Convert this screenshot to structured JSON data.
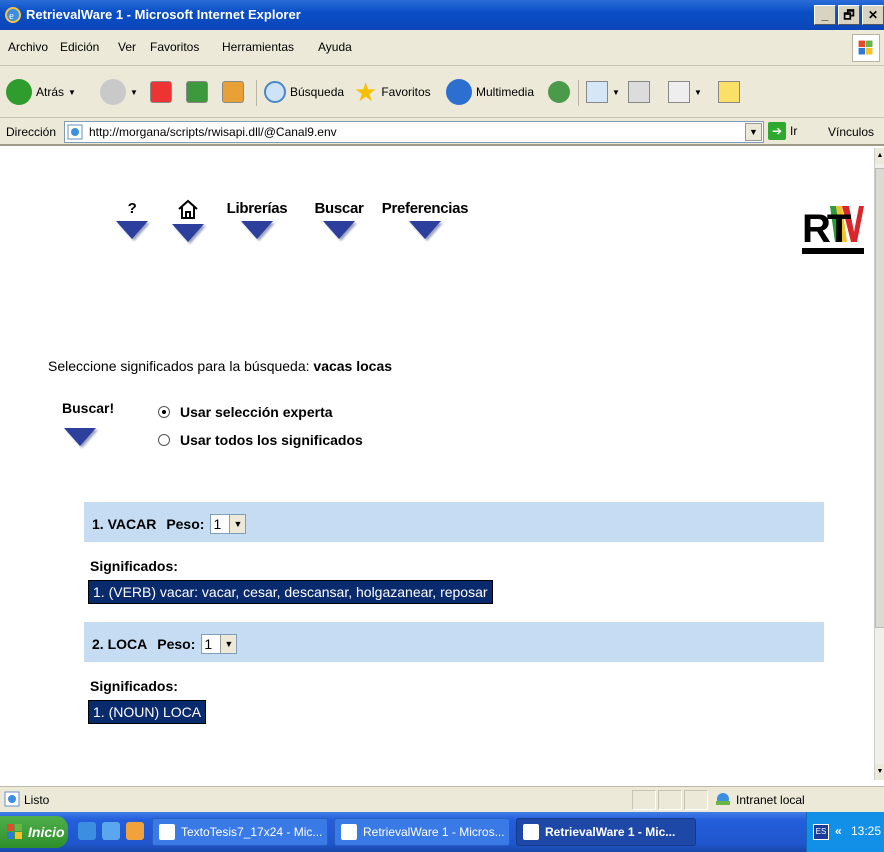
{
  "window": {
    "title": "RetrievalWare 1 - Microsoft Internet Explorer",
    "controls": [
      "_",
      "🗗",
      "✕"
    ]
  },
  "menu": [
    "Archivo",
    "Edición",
    "Ver",
    "Favoritos",
    "Herramientas",
    "Ayuda"
  ],
  "toolbar": {
    "back_label": "Atrás",
    "search_label": "Búsqueda",
    "favorites_label": "Favoritos",
    "media_label": "Multimedia"
  },
  "address": {
    "label": "Dirección",
    "url": "http://morgana/scripts/rwisapi.dll/@Canal9.env",
    "go_label": "Ir",
    "links_label": "Vínculos"
  },
  "nav": {
    "help": "?",
    "libraries": "Librerías",
    "search": "Buscar",
    "preferences": "Preferencias"
  },
  "logo_text": "RTVV",
  "search": {
    "prompt": "Seleccione significados para la búsqueda: ",
    "query": "vacas locas",
    "buscar_label": "Buscar!",
    "options": [
      {
        "label": "Usar selección experta",
        "checked": true
      },
      {
        "label": "Usar todos los significados",
        "checked": false
      }
    ]
  },
  "terms": [
    {
      "title": "1. VACAR",
      "peso_label": "Peso:",
      "peso": "1",
      "meanings_label": "Significados:",
      "meaning": "1. (VERB) vacar: vacar, cesar, descansar, holgazanear, reposar"
    },
    {
      "title": "2. LOCA",
      "peso_label": "Peso:",
      "peso": "1",
      "meanings_label": "Significados:",
      "meaning": "1. (NOUN) LOCA"
    }
  ],
  "status": {
    "text": "Listo",
    "zone": "Intranet local"
  },
  "taskbar": {
    "start": "Inicio",
    "tasks": [
      {
        "label": "TextoTesis7_17x24 - Mic...",
        "active": false
      },
      {
        "label": "RetrievalWare 1 - Micros...",
        "active": false
      },
      {
        "label": "RetrievalWare 1 - Mic...",
        "active": true
      }
    ],
    "lang": "ES",
    "tray_arrow": "«",
    "clock": "13:25"
  },
  "colors": {
    "title_bar": "#0a4fc6",
    "nav_triangle": "#2c3f9c",
    "term_band": "#c6dcf2",
    "meaning_box": "#0a2a6e"
  }
}
